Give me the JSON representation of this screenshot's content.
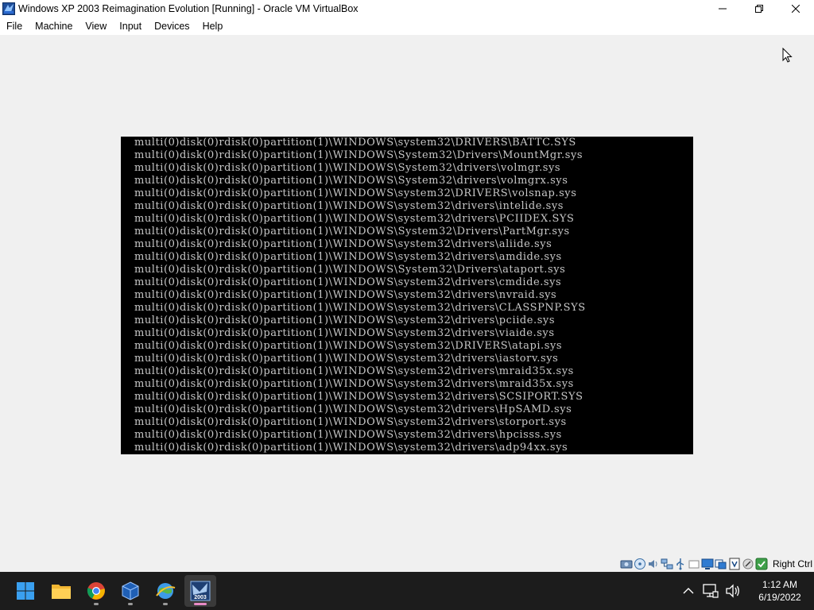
{
  "window": {
    "title": "Windows XP 2003 Reimagination Evolution [Running] - Oracle VM VirtualBox",
    "app_icon": "virtualbox-icon",
    "controls": [
      "minimize-icon",
      "restore-icon",
      "close-icon"
    ]
  },
  "menubar": {
    "items": [
      {
        "label": "File"
      },
      {
        "label": "Machine"
      },
      {
        "label": "View"
      },
      {
        "label": "Input"
      },
      {
        "label": "Devices"
      },
      {
        "label": "Help"
      }
    ]
  },
  "console": {
    "lines": [
      "multi(0)disk(0)rdisk(0)partition(1)\\WINDOWS\\system32\\DRIVERS\\BATTC.SYS",
      "multi(0)disk(0)rdisk(0)partition(1)\\WINDOWS\\System32\\Drivers\\MountMgr.sys",
      "multi(0)disk(0)rdisk(0)partition(1)\\WINDOWS\\System32\\drivers\\volmgr.sys",
      "multi(0)disk(0)rdisk(0)partition(1)\\WINDOWS\\System32\\drivers\\volmgrx.sys",
      "multi(0)disk(0)rdisk(0)partition(1)\\WINDOWS\\system32\\DRIVERS\\volsnap.sys",
      "multi(0)disk(0)rdisk(0)partition(1)\\WINDOWS\\system32\\drivers\\intelide.sys",
      "multi(0)disk(0)rdisk(0)partition(1)\\WINDOWS\\system32\\drivers\\PCIIDEX.SYS",
      "multi(0)disk(0)rdisk(0)partition(1)\\WINDOWS\\System32\\Drivers\\PartMgr.sys",
      "multi(0)disk(0)rdisk(0)partition(1)\\WINDOWS\\system32\\drivers\\aliide.sys",
      "multi(0)disk(0)rdisk(0)partition(1)\\WINDOWS\\system32\\drivers\\amdide.sys",
      "multi(0)disk(0)rdisk(0)partition(1)\\WINDOWS\\System32\\Drivers\\ataport.sys",
      "multi(0)disk(0)rdisk(0)partition(1)\\WINDOWS\\system32\\drivers\\cmdide.sys",
      "multi(0)disk(0)rdisk(0)partition(1)\\WINDOWS\\system32\\drivers\\nvraid.sys",
      "multi(0)disk(0)rdisk(0)partition(1)\\WINDOWS\\system32\\drivers\\CLASSPNP.SYS",
      "multi(0)disk(0)rdisk(0)partition(1)\\WINDOWS\\system32\\drivers\\pciide.sys",
      "multi(0)disk(0)rdisk(0)partition(1)\\WINDOWS\\system32\\drivers\\viaide.sys",
      "multi(0)disk(0)rdisk(0)partition(1)\\WINDOWS\\system32\\DRIVERS\\atapi.sys",
      "multi(0)disk(0)rdisk(0)partition(1)\\WINDOWS\\system32\\drivers\\iastorv.sys",
      "multi(0)disk(0)rdisk(0)partition(1)\\WINDOWS\\system32\\drivers\\mraid35x.sys",
      "multi(0)disk(0)rdisk(0)partition(1)\\WINDOWS\\system32\\drivers\\mraid35x.sys",
      "multi(0)disk(0)rdisk(0)partition(1)\\WINDOWS\\system32\\drivers\\SCSIPORT.SYS",
      "multi(0)disk(0)rdisk(0)partition(1)\\WINDOWS\\system32\\drivers\\HpSAMD.sys",
      "multi(0)disk(0)rdisk(0)partition(1)\\WINDOWS\\system32\\drivers\\storport.sys",
      "multi(0)disk(0)rdisk(0)partition(1)\\WINDOWS\\system32\\drivers\\hpcisss.sys",
      "multi(0)disk(0)rdisk(0)partition(1)\\WINDOWS\\system32\\drivers\\adp94xx.sys"
    ]
  },
  "statusbar": {
    "icons": [
      "hard-disk-icon",
      "optical-drive-icon",
      "audio-icon",
      "network-icon",
      "usb-icon",
      "shared-folders-icon",
      "display-icon",
      "video-capture-icon",
      "virtualization-icon",
      "mouse-integration-icon",
      "host-key-icon"
    ],
    "host_key": "Right Ctrl"
  },
  "taskbar": {
    "apps": [
      "windows-start-icon",
      "file-explorer-icon",
      "chrome-icon",
      "virtualbox-icon",
      "network-globe-icon",
      "vm-window-icon"
    ],
    "vm_thumb_label": "2003",
    "tray_icons": [
      "chevron-up-icon",
      "network-icon",
      "volume-icon"
    ],
    "time": "1:12 AM",
    "date": "6/19/2022"
  },
  "colors": {
    "console_bg": "#000000",
    "console_text": "#c8c8c8",
    "taskbar_bg": "#1c1c1c"
  }
}
